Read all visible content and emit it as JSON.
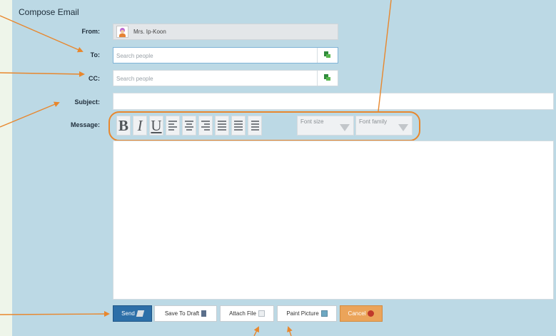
{
  "window": {
    "title": "Compose Email"
  },
  "form": {
    "from_label": "From:",
    "from_value": "Mrs. Ip-Koon",
    "to_label": "To:",
    "to_placeholder": "Search people",
    "cc_label": "CC:",
    "cc_placeholder": "Search people",
    "subject_label": "Subject:",
    "subject_value": "",
    "message_label": "Message:",
    "message_value": ""
  },
  "toolbar": {
    "bold": "B",
    "italic": "I",
    "underline": "U",
    "font_size": "Font size",
    "font_family": "Font family"
  },
  "actions": {
    "send": "Send",
    "save_draft": "Save To Draft",
    "attach_file": "Attach File",
    "paint_picture": "Paint Picture",
    "cancel": "Cancel"
  },
  "colors": {
    "panel": "#bcd9e5",
    "send": "#2d6fa8",
    "cancel": "#eba45a",
    "annotation": "#e8872d"
  },
  "icons": [
    "person-picker-icon",
    "align-left-icon",
    "align-center-icon",
    "align-right-icon",
    "justify-icon",
    "list-icon",
    "bullet-list-icon",
    "dropdown-icon",
    "send-icon",
    "draft-icon",
    "file-icon",
    "picture-icon",
    "cancel-icon"
  ]
}
